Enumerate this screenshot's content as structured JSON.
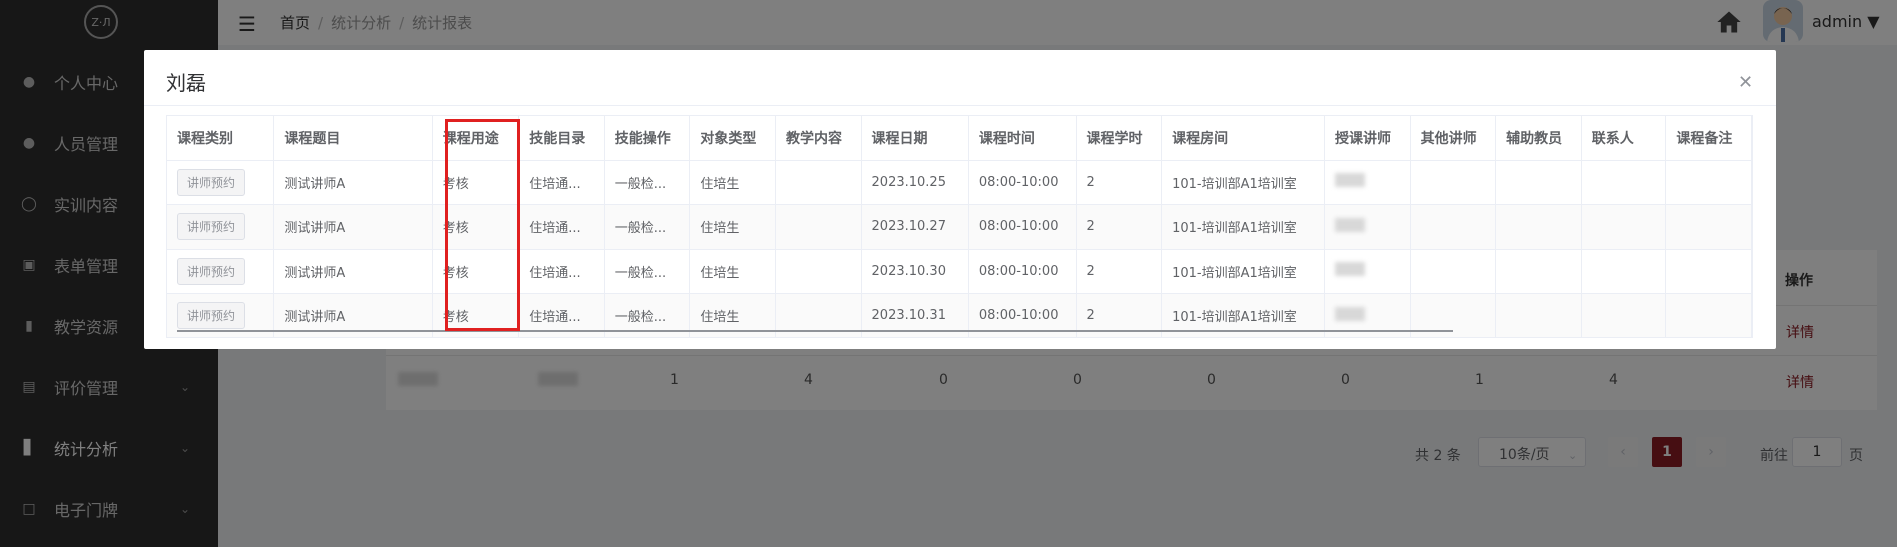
{
  "sidebar": {
    "logo": "Z·Л",
    "items": [
      {
        "label": "个人中心",
        "icon": "user-icon"
      },
      {
        "label": "人员管理",
        "icon": "users-icon"
      },
      {
        "label": "实训内容",
        "icon": "flask-icon"
      },
      {
        "label": "表单管理",
        "icon": "form-icon"
      },
      {
        "label": "教学资源",
        "icon": "book-icon"
      },
      {
        "label": "评价管理",
        "icon": "rating-icon"
      },
      {
        "label": "统计分析",
        "icon": "bar-chart-icon"
      },
      {
        "label": "电子门牌",
        "icon": "monitor-icon"
      }
    ]
  },
  "header": {
    "breadcrumb": [
      "首页",
      "统计分析",
      "统计报表"
    ],
    "username": "admin"
  },
  "background": {
    "op_header": "操作",
    "rows": [
      {
        "values": [
          "1",
          "4",
          "0",
          "0",
          "0",
          "0",
          "1",
          "4"
        ],
        "action": "详情"
      },
      {
        "values": [
          "",
          "",
          "",
          "",
          "",
          "",
          "",
          ""
        ],
        "action": "详情"
      }
    ],
    "pagination": {
      "total": "共 2 条",
      "page_size": "10条/页",
      "current": "1",
      "goto_label": "前往",
      "goto_value": "1",
      "page_suffix": "页"
    }
  },
  "dialog": {
    "title": "刘磊",
    "columns": [
      "课程类别",
      "课程题目",
      "课程用途",
      "技能目录",
      "技能操作",
      "对象类型",
      "教学内容",
      "课程日期",
      "课程时间",
      "课程学时",
      "课程房间",
      "授课讲师",
      "其他讲师",
      "辅助教员",
      "联系人",
      "课程备注"
    ],
    "rows": [
      [
        "讲师预约",
        "测试讲师A",
        "考核",
        "住培通...",
        "一般检...",
        "住培生",
        "",
        "2023.10.25",
        "08:00-10:00",
        "2",
        "101-培训部A1培训室",
        "",
        "",
        "",
        "",
        ""
      ],
      [
        "讲师预约",
        "测试讲师A",
        "考核",
        "住培通...",
        "一般检...",
        "住培生",
        "",
        "2023.10.27",
        "08:00-10:00",
        "2",
        "101-培训部A1培训室",
        "",
        "",
        "",
        "",
        ""
      ],
      [
        "讲师预约",
        "测试讲师A",
        "考核",
        "住培通...",
        "一般检...",
        "住培生",
        "",
        "2023.10.30",
        "08:00-10:00",
        "2",
        "101-培训部A1培训室",
        "",
        "",
        "",
        "",
        ""
      ],
      [
        "讲师预约",
        "测试讲师A",
        "考核",
        "住培通...",
        "一般检...",
        "住培生",
        "",
        "2023.10.31",
        "08:00-10:00",
        "2",
        "101-培训部A1培训室",
        "",
        "",
        "",
        "",
        ""
      ]
    ]
  },
  "colors": {
    "accent": "#8c1c24",
    "sidebar": "#2e2e2e",
    "highlight": "#e02020"
  }
}
